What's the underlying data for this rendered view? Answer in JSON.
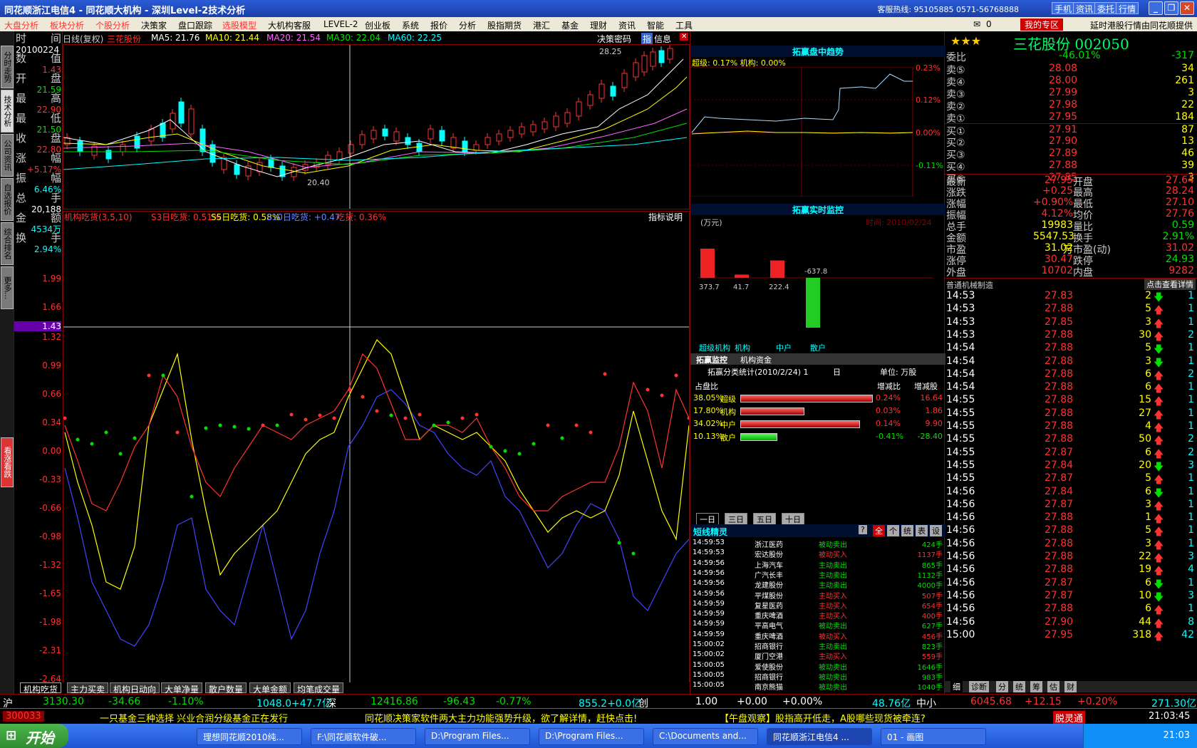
{
  "title": {
    "text": "同花顺浙江电信4 - 同花顺大机构 - 深圳Level-2技术分析",
    "hotline": "客服热线: 95105885 0571-56768888",
    "buttons": [
      "手机",
      "资讯",
      "委托",
      "行情"
    ]
  },
  "menu": [
    "大盘分析",
    "板块分析",
    "个股分析",
    "决策家",
    "盘口跟踪",
    "选股模型",
    "大机构客服",
    "LEVEL-2",
    "创业板",
    "系统",
    "报价",
    "分析",
    "股指期货",
    "港汇",
    "基金",
    "理财",
    "资讯",
    "智能",
    "工具"
  ],
  "menu_right": {
    "mail": "0",
    "zone": "我的专区",
    "notice": "延时港股行情由同花顺提供"
  },
  "left_tabs": [
    "分时走势",
    "技术分析",
    "公司资讯",
    "自选报价",
    "综合排名",
    "更多..."
  ],
  "side_badge": "看涨看跌",
  "info": {
    "labels": [
      "时",
      "间",
      "数",
      "值",
      "开",
      "盘",
      "最",
      "高",
      "最",
      "低",
      "收",
      "盘",
      "涨",
      "幅",
      "振",
      "幅",
      "总",
      "手",
      "金",
      "额",
      "换",
      "手"
    ],
    "values": [
      "20100224",
      "1.43",
      "21.59",
      "22.90",
      "21.50",
      "22.80",
      "+5.17%",
      "6.46%",
      "20,188",
      "4534万",
      "2.94%"
    ]
  },
  "kline": {
    "period": "日线(复权)",
    "name": "三花股份",
    "ma5": "MA5: 21.76",
    "ma10": "MA10: 21.44",
    "ma20": "MA20: 21.54",
    "ma30": "MA30: 22.04",
    "ma60": "MA60: 22.25",
    "hi_label": "28.25",
    "lo_label": "20.40",
    "tool1": "决策密码",
    "tool2": "指",
    "tool3": "信息"
  },
  "ind": {
    "title": "机构吃货(3,5,10)",
    "s3": "S3日吃货: 0.51%",
    "s5": "S5日吃货: 0.58%",
    "s10": "S10日吃货: +0.47",
    "eat": "吃货: 0.36%",
    "help": "指标说明",
    "yticks": [
      "1.99",
      "1.66",
      "1.43",
      "1.32",
      "0.99",
      "0.66",
      "0.34",
      "0.00",
      "-0.33",
      "-0.66",
      "-0.98",
      "-1.32",
      "-1.65",
      "-1.98",
      "-2.31",
      "-2.64"
    ]
  },
  "bottom_tabs": [
    "机构吃货",
    "主力买卖",
    "机构日动向",
    "大单净量",
    "散户数量",
    "大单金额",
    "均笔成交量"
  ],
  "mid": {
    "trend_title": "拓赢盘中趋势",
    "trend_legend": "超级: 0.17% 机构: 0.00%",
    "trend_ticks": [
      "0.23%",
      "0.12%",
      "0.00%",
      "-0.11%"
    ],
    "monitor_title": "拓赢实时监控",
    "unit": "(万元)",
    "time_label": "时间: 2010/02/24",
    "bars": [
      "373.7",
      "41.7",
      "222.4",
      "-637.8"
    ],
    "bar_labels": [
      "超级机构",
      "机构",
      "中户",
      "散户"
    ],
    "tabs": [
      "拓赢监控",
      "机构资金"
    ],
    "stat_title": "拓赢分类统计(2010/2/24) 1",
    "stat_day": "日",
    "stat_unit": "单位: 万股",
    "share": "占盘比",
    "chg": "增减比",
    "chgv": "增减股",
    "stats": [
      {
        "pct": "38.05%",
        "name": "超级",
        "chg": "0.24%",
        "v": "16.64"
      },
      {
        "pct": "17.80%",
        "name": "机构",
        "chg": "0.03%",
        "v": "1.86"
      },
      {
        "pct": "34.02%",
        "name": "中户",
        "chg": "0.14%",
        "v": "9.90"
      },
      {
        "pct": "10.13%",
        "name": "散户",
        "chg": "-0.41%",
        "v": "-28.40"
      }
    ],
    "day_tabs": [
      "一日",
      "三日",
      "五日",
      "十日"
    ],
    "elf_title": "短线精灵",
    "elf_btns": [
      "?",
      "全",
      "个",
      "统",
      "表",
      "设"
    ],
    "elf": [
      [
        "14:59:53",
        "浙江医药",
        "被动卖出",
        "424手"
      ],
      [
        "14:59:53",
        "宏达股份",
        "被动买入",
        "1137手"
      ],
      [
        "14:59:56",
        "上海汽车",
        "主动卖出",
        "865手"
      ],
      [
        "14:59:56",
        "广汽长丰",
        "主动卖出",
        "1132手"
      ],
      [
        "14:59:56",
        "龙建股份",
        "主动卖出",
        "4000手"
      ],
      [
        "14:59:56",
        "平煤股份",
        "主动买入",
        "507手"
      ],
      [
        "14:59:59",
        "复星医药",
        "主动买入",
        "654手"
      ],
      [
        "14:59:59",
        "重庆啤酒",
        "主动买入",
        "400手"
      ],
      [
        "14:59:59",
        "平高电气",
        "被动卖出",
        "627手"
      ],
      [
        "14:59:59",
        "重庆啤酒",
        "被动买入",
        "456手"
      ],
      [
        "15:00:02",
        "招商银行",
        "主动卖出",
        "823手"
      ],
      [
        "15:00:02",
        "厦门空港",
        "主动买入",
        "559手"
      ],
      [
        "15:00:05",
        "爱使股份",
        "被动卖出",
        "1646手"
      ],
      [
        "15:00:05",
        "招商银行",
        "被动卖出",
        "983手"
      ],
      [
        "15:00:05",
        "南京熊猫",
        "被动卖出",
        "1040手"
      ]
    ]
  },
  "right": {
    "stars": "★★★",
    "stock": "三花股份 002050",
    "wb": {
      "l": "委比",
      "v": "-46.01%",
      "n": "-317"
    },
    "book": [
      [
        "卖⑤",
        "28.08",
        "34"
      ],
      [
        "卖④",
        "28.00",
        "261"
      ],
      [
        "卖③",
        "27.99",
        "3"
      ],
      [
        "卖②",
        "27.98",
        "22"
      ],
      [
        "卖①",
        "27.95",
        "184"
      ],
      [
        "买①",
        "27.91",
        "87"
      ],
      [
        "买②",
        "27.90",
        "13"
      ],
      [
        "买③",
        "27.89",
        "46"
      ],
      [
        "买④",
        "27.88",
        "39"
      ],
      [
        "买⑤",
        "27.85",
        "3"
      ]
    ],
    "stats": [
      [
        "最新",
        "27.95",
        "开盘",
        "27.64"
      ],
      [
        "涨跌",
        "+0.25",
        "最高",
        "28.24"
      ],
      [
        "涨幅",
        "+0.90%",
        "最低",
        "27.10"
      ],
      [
        "振幅",
        "4.12%",
        "均价",
        "27.76"
      ],
      [
        "总手",
        "19983",
        "量比",
        "0.59"
      ],
      [
        "金额",
        "5547.53万",
        "换手",
        "2.91%"
      ],
      [
        "市盈",
        "31.02",
        "市盈(动)",
        "31.02"
      ],
      [
        "涨停",
        "30.47",
        "跌停",
        "24.93"
      ],
      [
        "外盘",
        "10702",
        "内盘",
        "9282"
      ]
    ],
    "industry": "普通机械制造",
    "detail_btn": "点击查看详情",
    "ticks": [
      [
        "14:53",
        "27.83",
        "2",
        "dn",
        "1"
      ],
      [
        "14:53",
        "27.88",
        "5",
        "up",
        "1"
      ],
      [
        "14:53",
        "27.85",
        "3",
        "up",
        "1"
      ],
      [
        "14:53",
        "27.88",
        "30",
        "up",
        "2"
      ],
      [
        "14:54",
        "27.88",
        "5",
        "dn",
        "1"
      ],
      [
        "14:54",
        "27.88",
        "3",
        "dn",
        "1"
      ],
      [
        "14:54",
        "27.88",
        "6",
        "up",
        "2"
      ],
      [
        "14:54",
        "27.88",
        "6",
        "up",
        "1"
      ],
      [
        "14:55",
        "27.88",
        "15",
        "up",
        "1"
      ],
      [
        "14:55",
        "27.88",
        "27",
        "up",
        "1"
      ],
      [
        "14:55",
        "27.88",
        "4",
        "up",
        "1"
      ],
      [
        "14:55",
        "27.88",
        "50",
        "up",
        "2"
      ],
      [
        "14:55",
        "27.87",
        "6",
        "up",
        "2"
      ],
      [
        "14:55",
        "27.84",
        "20",
        "dn",
        "3"
      ],
      [
        "14:55",
        "27.87",
        "5",
        "up",
        "1"
      ],
      [
        "14:56",
        "27.84",
        "6",
        "dn",
        "1"
      ],
      [
        "14:56",
        "27.87",
        "3",
        "up",
        "1"
      ],
      [
        "14:56",
        "27.88",
        "1",
        "up",
        "1"
      ],
      [
        "14:56",
        "27.88",
        "5",
        "up",
        "1"
      ],
      [
        "14:56",
        "27.88",
        "3",
        "up",
        "1"
      ],
      [
        "14:56",
        "27.88",
        "22",
        "up",
        "3"
      ],
      [
        "14:56",
        "27.88",
        "19",
        "up",
        "4"
      ],
      [
        "14:56",
        "27.87",
        "6",
        "dn",
        "1"
      ],
      [
        "14:56",
        "27.87",
        "10",
        "dn",
        "3"
      ],
      [
        "14:56",
        "27.88",
        "6",
        "up",
        "1"
      ],
      [
        "14:56",
        "27.90",
        "44",
        "up",
        "8"
      ],
      [
        "15:00",
        "27.95",
        "318",
        "up",
        "42"
      ]
    ],
    "bottom_tabs": [
      "细",
      "诊断",
      "分",
      "统",
      "筹",
      "估",
      "财"
    ]
  },
  "status": {
    "sh": "沪",
    "shv": "3130.30",
    "shc": "-34.66",
    "shp": "-1.10%",
    "sha": "1048.0+47.7亿",
    "sz": "深",
    "szv": "12416.86",
    "szc": "-96.43",
    "szp": "-0.77%",
    "sza": "855.2+0.0亿",
    "cy": "创",
    "cyv": "1.00",
    "cyc": "+0.00",
    "cyp": "+0.00%",
    "cya": "48.76亿",
    "zx": "中小",
    "zxv": "6045.68",
    "zxc": "+12.15",
    "zxp": "+0.20%",
    "zxa": "271.30亿"
  },
  "news": {
    "code": "300033",
    "n1": "一只基金三种选择 兴业合润分级基金正在发行",
    "n2": "同花顺决策家软件两大主力功能强势升级，欲了解详情，赶快点击!",
    "n3": "【午盘观察】股指高开低走，A股哪些现货被牵连?",
    "n4": "脱灵通",
    "time": "21:03:45"
  },
  "taskbar": {
    "start": "开始",
    "tasks": [
      "理想同花顺2010纯...",
      "F:\\同花顺软件破...",
      "D:\\Program Files...",
      "D:\\Program Files...",
      "C:\\Documents and...",
      "同花顺浙江电信4 ...",
      "01 - 画图"
    ],
    "clock": "21:03"
  }
}
